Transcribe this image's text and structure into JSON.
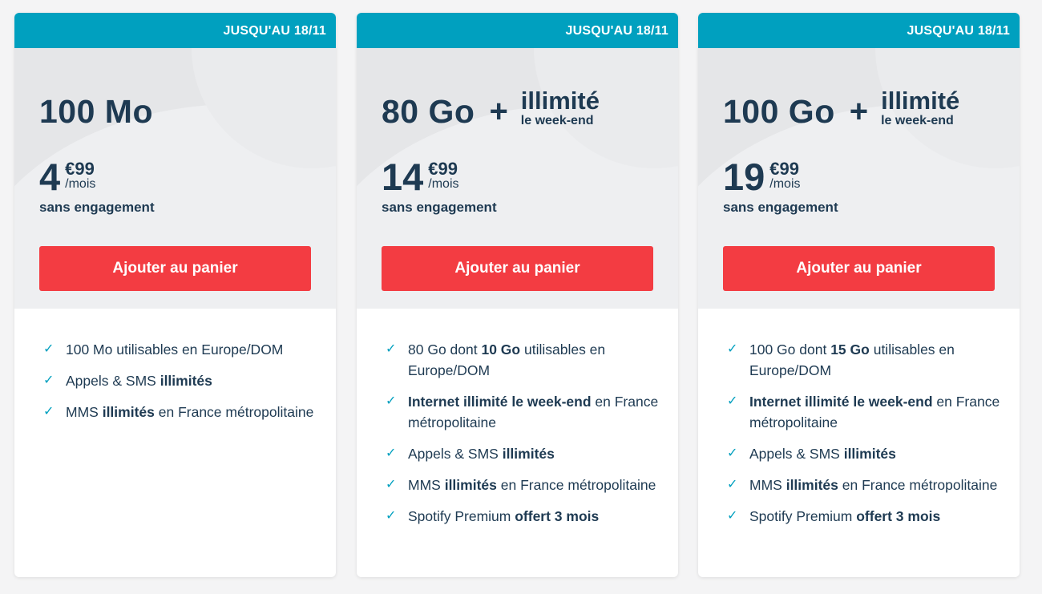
{
  "offers": [
    {
      "promo": "JUSQU'AU 18/11",
      "data": "100 Mo",
      "plus": "",
      "bonus_main": "",
      "bonus_sub": "",
      "price_int": "4",
      "price_dec": "€99",
      "price_unit": "/mois",
      "commitment": "sans engagement",
      "cta": "Ajouter au panier",
      "features": [
        [
          {
            "t": "100 Mo utilisables en Europe/DOM",
            "b": false
          }
        ],
        [
          {
            "t": "Appels & SMS ",
            "b": false
          },
          {
            "t": "illimités",
            "b": true
          }
        ],
        [
          {
            "t": "MMS ",
            "b": false
          },
          {
            "t": "illimités",
            "b": true
          },
          {
            "t": " en France métropolitaine",
            "b": false
          }
        ]
      ]
    },
    {
      "promo": "JUSQU'AU 18/11",
      "data": "80 Go",
      "plus": "+",
      "bonus_main": "illimité",
      "bonus_sub": "le week-end",
      "price_int": "14",
      "price_dec": "€99",
      "price_unit": "/mois",
      "commitment": "sans engagement",
      "cta": "Ajouter au panier",
      "features": [
        [
          {
            "t": "80 Go dont ",
            "b": false
          },
          {
            "t": "10 Go",
            "b": true
          },
          {
            "t": " utilisables en Europe/DOM",
            "b": false
          }
        ],
        [
          {
            "t": "Internet illimité le week-end",
            "b": true
          },
          {
            "t": " en France métropolitaine",
            "b": false
          }
        ],
        [
          {
            "t": "Appels & SMS ",
            "b": false
          },
          {
            "t": "illimités",
            "b": true
          }
        ],
        [
          {
            "t": "MMS ",
            "b": false
          },
          {
            "t": "illimités",
            "b": true
          },
          {
            "t": " en France métropolitaine",
            "b": false
          }
        ],
        [
          {
            "t": "Spotify Premium ",
            "b": false
          },
          {
            "t": "offert 3 mois",
            "b": true
          }
        ]
      ]
    },
    {
      "promo": "JUSQU'AU 18/11",
      "data": "100 Go",
      "plus": "+",
      "bonus_main": "illimité",
      "bonus_sub": "le week-end",
      "price_int": "19",
      "price_dec": "€99",
      "price_unit": "/mois",
      "commitment": "sans engagement",
      "cta": "Ajouter au panier",
      "features": [
        [
          {
            "t": "100 Go dont ",
            "b": false
          },
          {
            "t": "15 Go",
            "b": true
          },
          {
            "t": " utilisables en Europe/DOM",
            "b": false
          }
        ],
        [
          {
            "t": "Internet illimité le week-end",
            "b": true
          },
          {
            "t": " en France métropolitaine",
            "b": false
          }
        ],
        [
          {
            "t": "Appels & SMS ",
            "b": false
          },
          {
            "t": "illimités",
            "b": true
          }
        ],
        [
          {
            "t": "MMS ",
            "b": false
          },
          {
            "t": "illimités",
            "b": true
          },
          {
            "t": " en France métropolitaine",
            "b": false
          }
        ],
        [
          {
            "t": "Spotify Premium ",
            "b": false
          },
          {
            "t": "offert 3 mois",
            "b": true
          }
        ]
      ]
    }
  ],
  "colors": {
    "promo_band": "#00a0bf",
    "cta": "#f33c42",
    "text": "#1e3a52",
    "check": "#00a0bf"
  },
  "icons": {
    "feature_bullet": "check-icon",
    "feature_bullet_glyph": "✓"
  }
}
